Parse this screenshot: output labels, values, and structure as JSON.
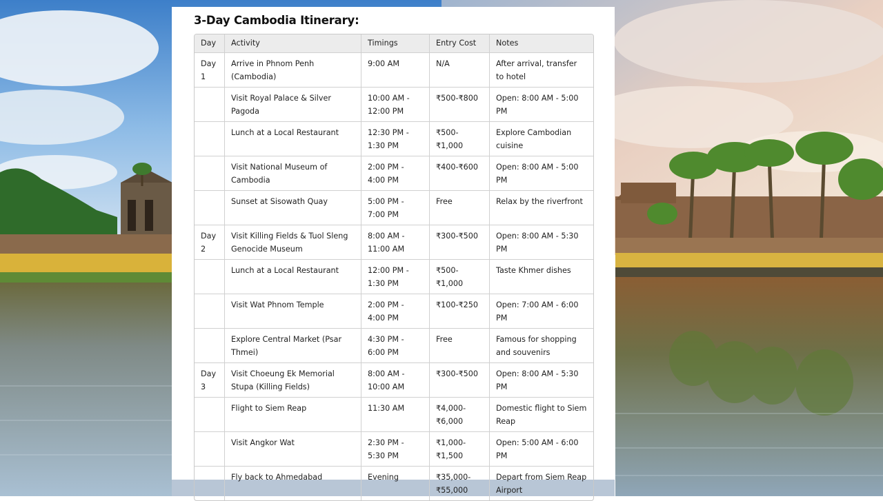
{
  "document": {
    "title": "3-Day Cambodia Itinerary:",
    "columns": [
      "Day",
      "Activity",
      "Timings",
      "Entry Cost",
      "Notes"
    ],
    "rows": [
      {
        "day": "Day 1",
        "activity": "Arrive in Phnom Penh (Cambodia)",
        "timings": "9:00 AM",
        "cost": "N/A",
        "notes": "After arrival, transfer to hotel"
      },
      {
        "day": "",
        "activity": "Visit Royal Palace & Silver Pagoda",
        "timings": "10:00 AM - 12:00 PM",
        "cost": "₹500-₹800",
        "notes": "Open: 8:00 AM - 5:00 PM"
      },
      {
        "day": "",
        "activity": "Lunch at a Local Restaurant",
        "timings": "12:30 PM - 1:30 PM",
        "cost": "₹500-₹1,000",
        "notes": "Explore Cambodian cuisine"
      },
      {
        "day": "",
        "activity": "Visit National Museum of Cambodia",
        "timings": "2:00 PM - 4:00 PM",
        "cost": "₹400-₹600",
        "notes": "Open: 8:00 AM - 5:00 PM"
      },
      {
        "day": "",
        "activity": "Sunset at Sisowath Quay",
        "timings": "5:00 PM - 7:00 PM",
        "cost": "Free",
        "notes": "Relax by the riverfront"
      },
      {
        "day": "Day 2",
        "activity": "Visit Killing Fields & Tuol Sleng Genocide Museum",
        "timings": "8:00 AM - 11:00 AM",
        "cost": "₹300-₹500",
        "notes": "Open: 8:00 AM - 5:30 PM"
      },
      {
        "day": "",
        "activity": "Lunch at a Local Restaurant",
        "timings": "12:00 PM - 1:30 PM",
        "cost": "₹500-₹1,000",
        "notes": "Taste Khmer dishes"
      },
      {
        "day": "",
        "activity": "Visit Wat Phnom Temple",
        "timings": "2:00 PM - 4:00 PM",
        "cost": "₹100-₹250",
        "notes": "Open: 7:00 AM - 6:00 PM"
      },
      {
        "day": "",
        "activity": "Explore Central Market (Psar Thmei)",
        "timings": "4:30 PM - 6:00 PM",
        "cost": "Free",
        "notes": "Famous for shopping and souvenirs"
      },
      {
        "day": "Day 3",
        "activity": "Visit Choeung Ek Memorial Stupa (Killing Fields)",
        "timings": "8:00 AM - 10:00 AM",
        "cost": "₹300-₹500",
        "notes": "Open: 8:00 AM - 5:30 PM"
      },
      {
        "day": "",
        "activity": "Flight to Siem Reap",
        "timings": "11:30 AM",
        "cost": "₹4,000-₹6,000",
        "notes": "Domestic flight to Siem Reap"
      },
      {
        "day": "",
        "activity": "Visit Angkor Wat",
        "timings": "2:30 PM - 5:30 PM",
        "cost": "₹1,000-₹1,500",
        "notes": "Open: 5:00 AM - 6:00 PM"
      },
      {
        "day": "",
        "activity": "Fly back to Ahmedabad",
        "timings": "Evening",
        "cost": "₹35,000-₹55,000",
        "notes": "Depart from Siem Reap Airport"
      }
    ]
  },
  "colors": {
    "sky": "#5f9fd8",
    "water": "#6f8da3",
    "grass": "#d9b23a",
    "card": "#ffffff",
    "header_bg": "#ececec",
    "border": "#d0d0d0"
  }
}
